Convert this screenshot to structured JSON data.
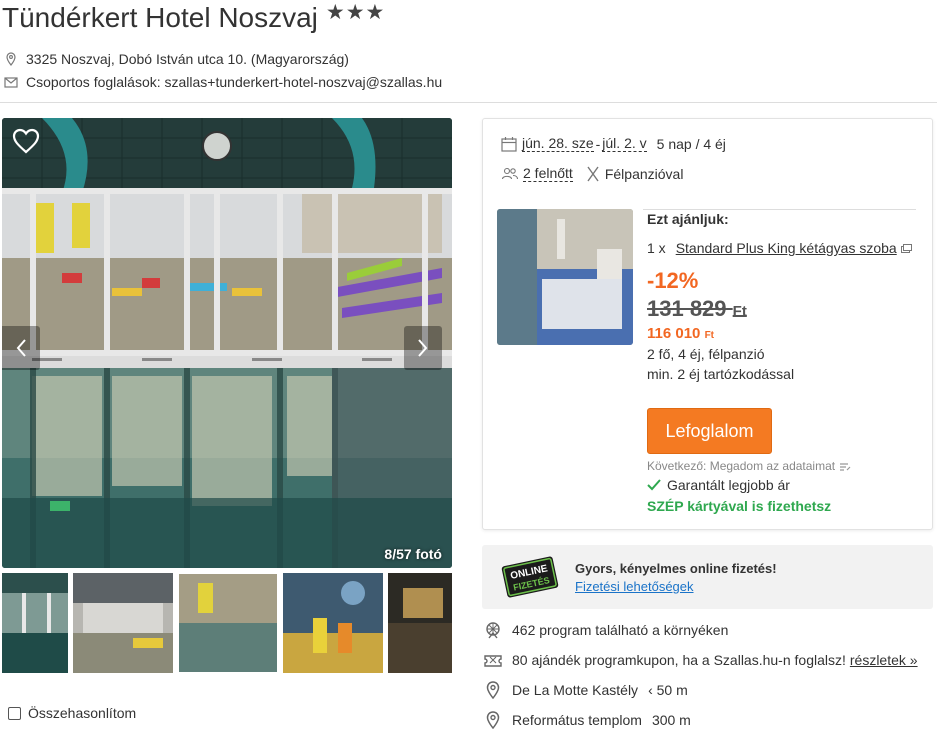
{
  "header": {
    "hotel_name": "Tündérkert Hotel Noszvaj",
    "stars": "★★★",
    "address": "3325 Noszvaj, Dobó István utca 10. (Magyarország)",
    "group_booking": "Csoportos foglalások: szallas+tunderkert-hotel-noszvaj@szallas.hu"
  },
  "gallery": {
    "photo_count": "8/57 fotó",
    "compare_label": "Összehasonlítom"
  },
  "booking": {
    "date_from": "jún. 28. sze",
    "date_sep": "-",
    "date_to": "júl. 2. v",
    "duration": "5 nap / 4 éj",
    "guests": "2 felnőtt",
    "board": "Félpanzióval",
    "recommend_label": "Ezt ajánljuk:",
    "room_qty": "1 x",
    "room_name": "Standard Plus King kétágyas szoba",
    "discount": "-12%",
    "old_price": "131 829",
    "new_price": "116 010",
    "currency": "Ft",
    "details_line1": "2 fő,  4 éj,  félpanzió",
    "details_line2": "min. 2 éj tartózkodással",
    "book_button": "Lefoglalom",
    "next_step": "Következő: Megadom az adataimat",
    "guarantee": "Garantált legjobb ár",
    "szep": "SZÉP kártyával is fizethetsz"
  },
  "payment": {
    "badge_line1": "ONLINE",
    "badge_line2": "FIZETÉS",
    "title": "Gyors, kényelmes online fizetés!",
    "link": "Fizetési lehetőségek"
  },
  "facts": {
    "programs": "462 program található a környéken",
    "coupons": "80 ajándék programkupon, ha a Szallas.hu-n foglalsz!",
    "coupons_link": "részletek »",
    "poi1_name": "De La Motte Kastély",
    "poi1_dist": "‹ 50 m",
    "poi2_name": "Református templom",
    "poi2_dist": "300 m"
  },
  "colors": {
    "accent": "#f26722",
    "button": "#f47a22",
    "green": "#2fa84f",
    "link": "#1a73c8"
  }
}
